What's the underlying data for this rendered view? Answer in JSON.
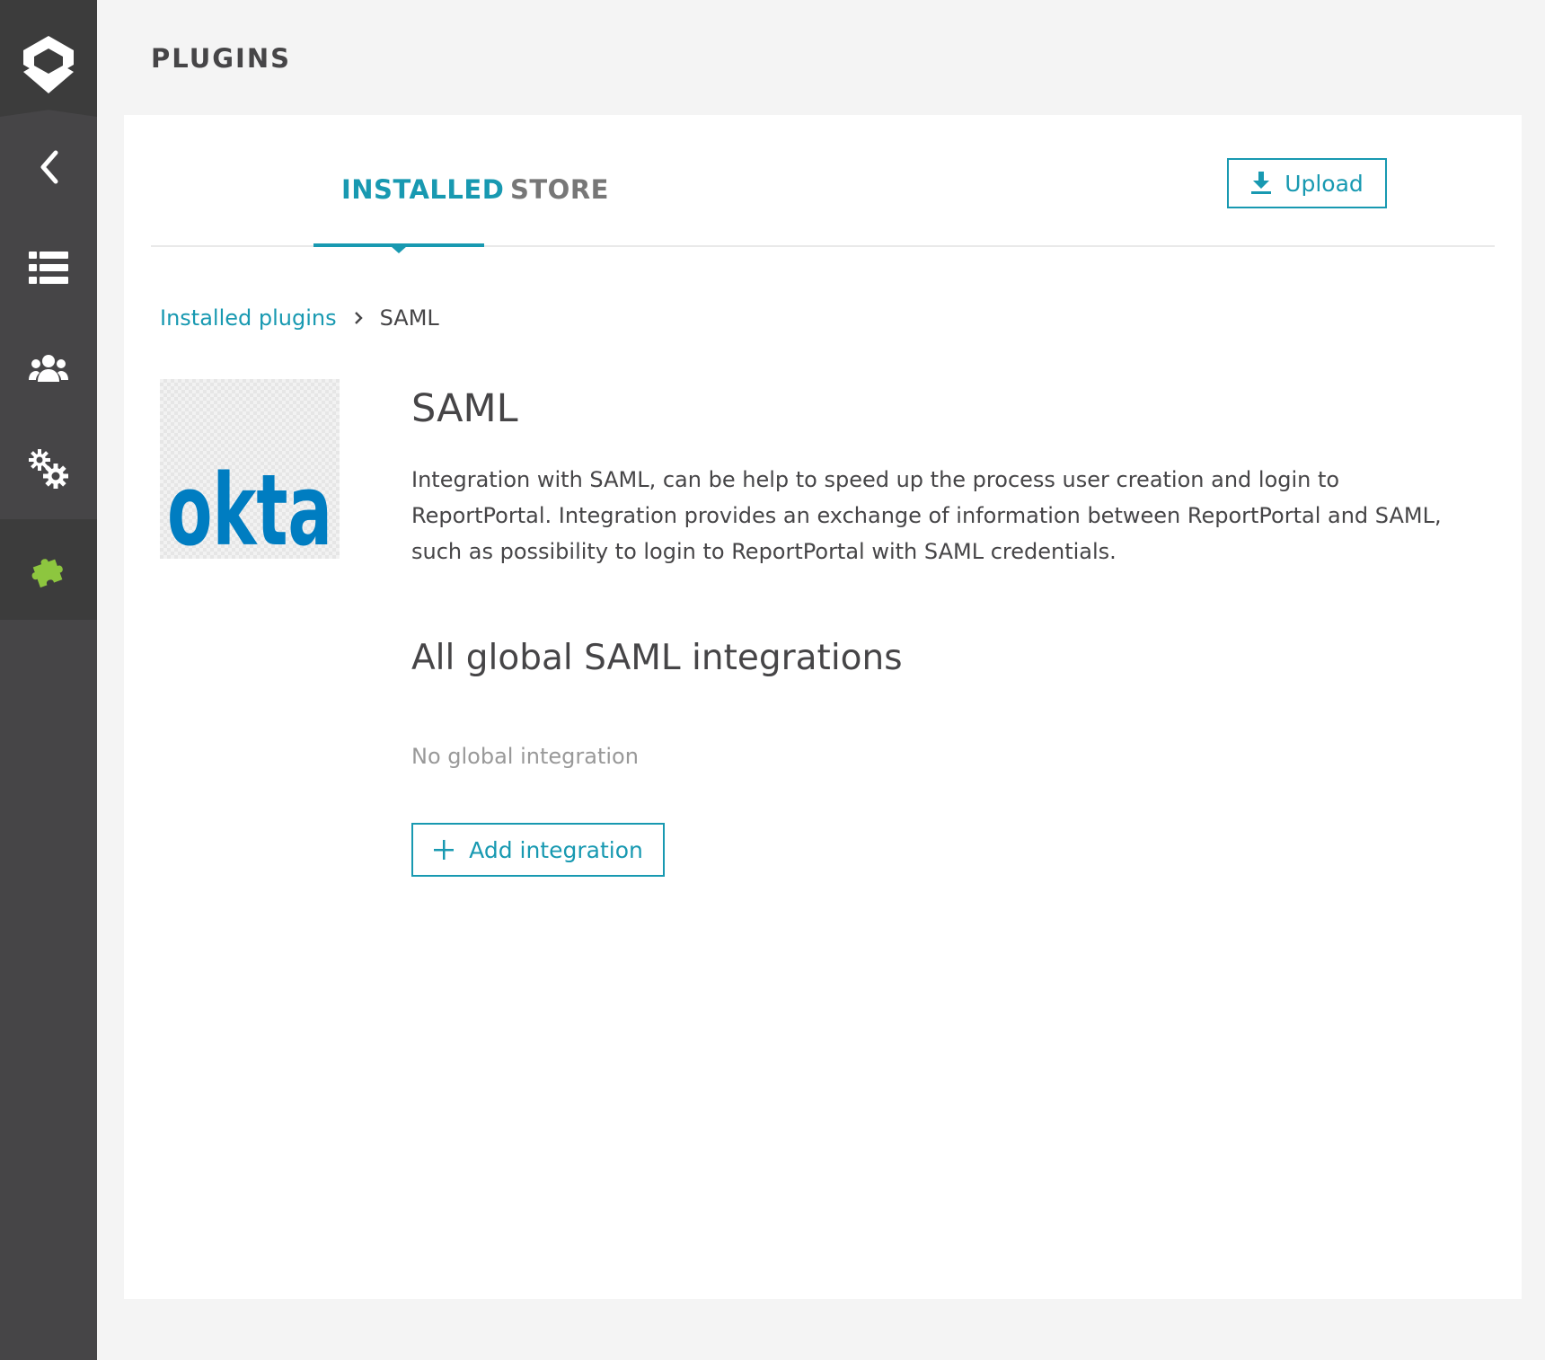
{
  "app": {
    "page_title": "PLUGINS"
  },
  "sidebar": {
    "items": [
      {
        "icon": "back-arrow-icon"
      },
      {
        "icon": "list-icon"
      },
      {
        "icon": "users-icon"
      },
      {
        "icon": "gears-icon"
      },
      {
        "icon": "puzzle-icon",
        "active": true
      }
    ],
    "active_color": "#8dc63f"
  },
  "tabs": {
    "installed": "INSTALLED",
    "store": "STORE",
    "active": "installed"
  },
  "toolbar": {
    "upload_label": "Upload"
  },
  "breadcrumb": {
    "parent": "Installed plugins",
    "current": "SAML"
  },
  "plugin": {
    "logo_text": "okta",
    "name": "SAML",
    "description": "Integration with SAML, can be help to speed up the process user creation and login to ReportPortal. Integration provides an exchange of information between ReportPortal and SAML, such as possibility to login to ReportPortal with SAML credentials."
  },
  "integrations": {
    "section_title": "All global SAML integrations",
    "empty_message": "No global integration",
    "add_label": "Add integration"
  },
  "colors": {
    "accent": "#1899b1",
    "sidebar_bg": "#464547",
    "okta_blue": "#007dc1"
  }
}
